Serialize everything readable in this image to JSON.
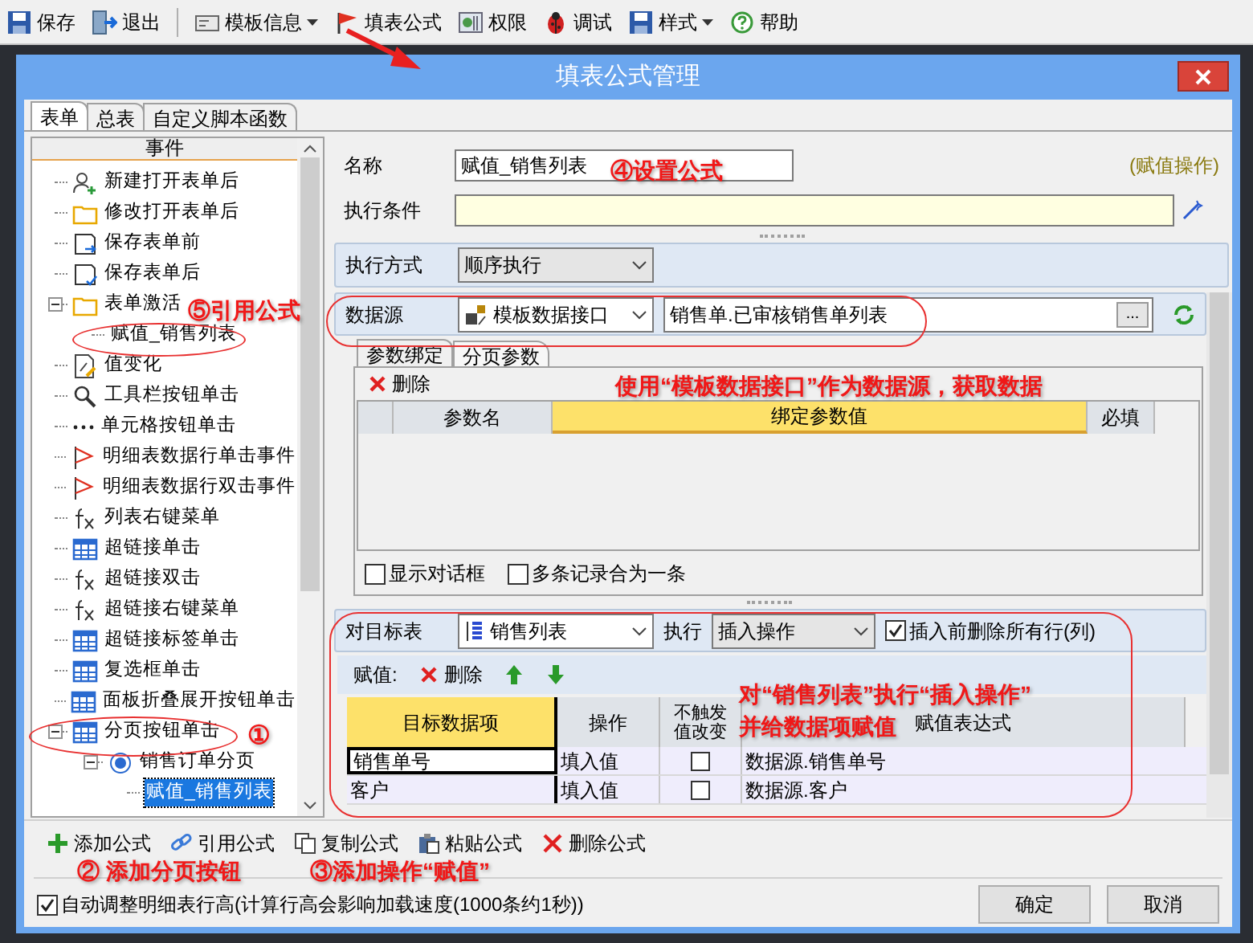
{
  "toolbar": [
    {
      "label": "保存",
      "kind": "save",
      "has_menu": false
    },
    {
      "label": "退出",
      "kind": "exit",
      "has_menu": false
    },
    {
      "label": "模板信息",
      "kind": "template",
      "has_menu": true
    },
    {
      "label": "填表公式",
      "kind": "flag",
      "has_menu": false
    },
    {
      "label": "权限",
      "kind": "permission",
      "has_menu": false
    },
    {
      "label": "调试",
      "kind": "bug",
      "has_menu": false
    },
    {
      "label": "样式",
      "kind": "save",
      "has_menu": true
    },
    {
      "label": "帮助",
      "kind": "help",
      "has_menu": false
    }
  ],
  "dialog": {
    "title": "填表公式管理",
    "tabs": [
      {
        "label": "表单",
        "selected": true
      },
      {
        "label": "总表",
        "selected": false
      },
      {
        "label": "自定义脚本函数",
        "selected": false
      }
    ],
    "tree": {
      "header": "事件",
      "items": [
        {
          "label": "新建打开表单后",
          "kind": "user-add",
          "selected": false
        },
        {
          "label": "修改打开表单后",
          "kind": "folder",
          "selected": false
        },
        {
          "label": "保存表单前",
          "kind": "save-arrow",
          "selected": false
        },
        {
          "label": "保存表单后",
          "kind": "save-check",
          "selected": false
        },
        {
          "label": "表单激活",
          "kind": "folder",
          "selected": false,
          "expanded": true,
          "children": [
            {
              "label": "赋值_销售列表",
              "selected": false
            }
          ]
        },
        {
          "label": "值变化",
          "kind": "doc-edit",
          "selected": false
        },
        {
          "label": "工具栏按钮单击",
          "kind": "search",
          "selected": false
        },
        {
          "label": "单元格按钮单击",
          "kind": "dots",
          "selected": false
        },
        {
          "label": "明细表数据行单击事件",
          "kind": "flag",
          "selected": false
        },
        {
          "label": "明细表数据行双击事件",
          "kind": "flag",
          "selected": false
        },
        {
          "label": "列表右键菜单",
          "kind": "fx",
          "selected": false
        },
        {
          "label": "超链接单击",
          "kind": "grid",
          "selected": false
        },
        {
          "label": "超链接双击",
          "kind": "fx",
          "selected": false
        },
        {
          "label": "超链接右键菜单",
          "kind": "fx",
          "selected": false
        },
        {
          "label": "超链接标签单击",
          "kind": "grid",
          "selected": false
        },
        {
          "label": "复选框单击",
          "kind": "grid",
          "selected": false
        },
        {
          "label": "面板折叠展开按钮单击",
          "kind": "grid",
          "selected": false
        },
        {
          "label": "分页按钮单击",
          "kind": "grid",
          "selected": false,
          "expanded": true,
          "children": [
            {
              "label": "销售订单分页",
              "kind": "radio",
              "selected": false,
              "expanded": true,
              "children": [
                {
                  "label": "赋值_销售列表",
                  "selected": true
                }
              ]
            }
          ]
        }
      ]
    },
    "form": {
      "name_label": "名称",
      "name_value": "赋值_销售列表",
      "operation_hint": "(赋值操作)",
      "condition_label": "执行条件",
      "exec_mode_label": "执行方式",
      "exec_mode_value": "顺序执行",
      "source_label": "数据源",
      "source_type": "模板数据接口",
      "source_value": "销售单.已审核销售单列表",
      "browse_button": "...",
      "param_tabs": [
        {
          "label": "参数绑定",
          "selected": true
        },
        {
          "label": "分页参数",
          "selected": false
        }
      ],
      "param_delete": "删除",
      "param_columns": [
        {
          "label": "参数名",
          "selected": false
        },
        {
          "label": "绑定参数值",
          "selected": true
        },
        {
          "label": "必填",
          "selected": false
        }
      ],
      "param_options": [
        {
          "label": "显示对话框",
          "checked": false
        },
        {
          "label": "多条记录合为一条",
          "checked": false
        }
      ],
      "target_label": "对目标表",
      "target_value": "销售列表",
      "exec_label": "执行",
      "exec_value": "插入操作",
      "clear_option": {
        "label": "插入前删除所有行(列)",
        "checked": true
      },
      "assign_label": "赋值:",
      "assign_delete": "删除",
      "columns": [
        {
          "label": "目标数据项",
          "selected": true
        },
        {
          "label": "操作",
          "selected": false
        },
        {
          "label": "不触发值改变",
          "selected": false
        },
        {
          "label": "赋值表达式",
          "selected": false
        }
      ],
      "rows": [
        {
          "target": "销售单号",
          "op": "填入值",
          "no_trigger": false,
          "expr": "数据源.销售单号",
          "selected": true
        },
        {
          "target": "客户",
          "op": "填入值",
          "no_trigger": false,
          "expr": "数据源.客户",
          "selected": false
        }
      ]
    },
    "footer_toolbar": [
      {
        "label": "添加公式",
        "kind": "add"
      },
      {
        "label": "引用公式",
        "kind": "link"
      },
      {
        "label": "复制公式",
        "kind": "copy"
      },
      {
        "label": "粘贴公式",
        "kind": "paste"
      },
      {
        "label": "删除公式",
        "kind": "delete"
      }
    ],
    "auto_height": {
      "label": "自动调整明细表行高(计算行高会影响加载速度(1000条约1秒))",
      "checked": true
    },
    "buttons": [
      "确定",
      "取消"
    ]
  },
  "annotations": [
    "⑤引用公式",
    "①",
    "④设置公式",
    "使用“模板数据接口”作为数据源，获取数据",
    "对“销售列表”执行“插入操作”",
    "并给数据项赋值",
    "② 添加分页按钮",
    "③添加操作“赋值”"
  ]
}
